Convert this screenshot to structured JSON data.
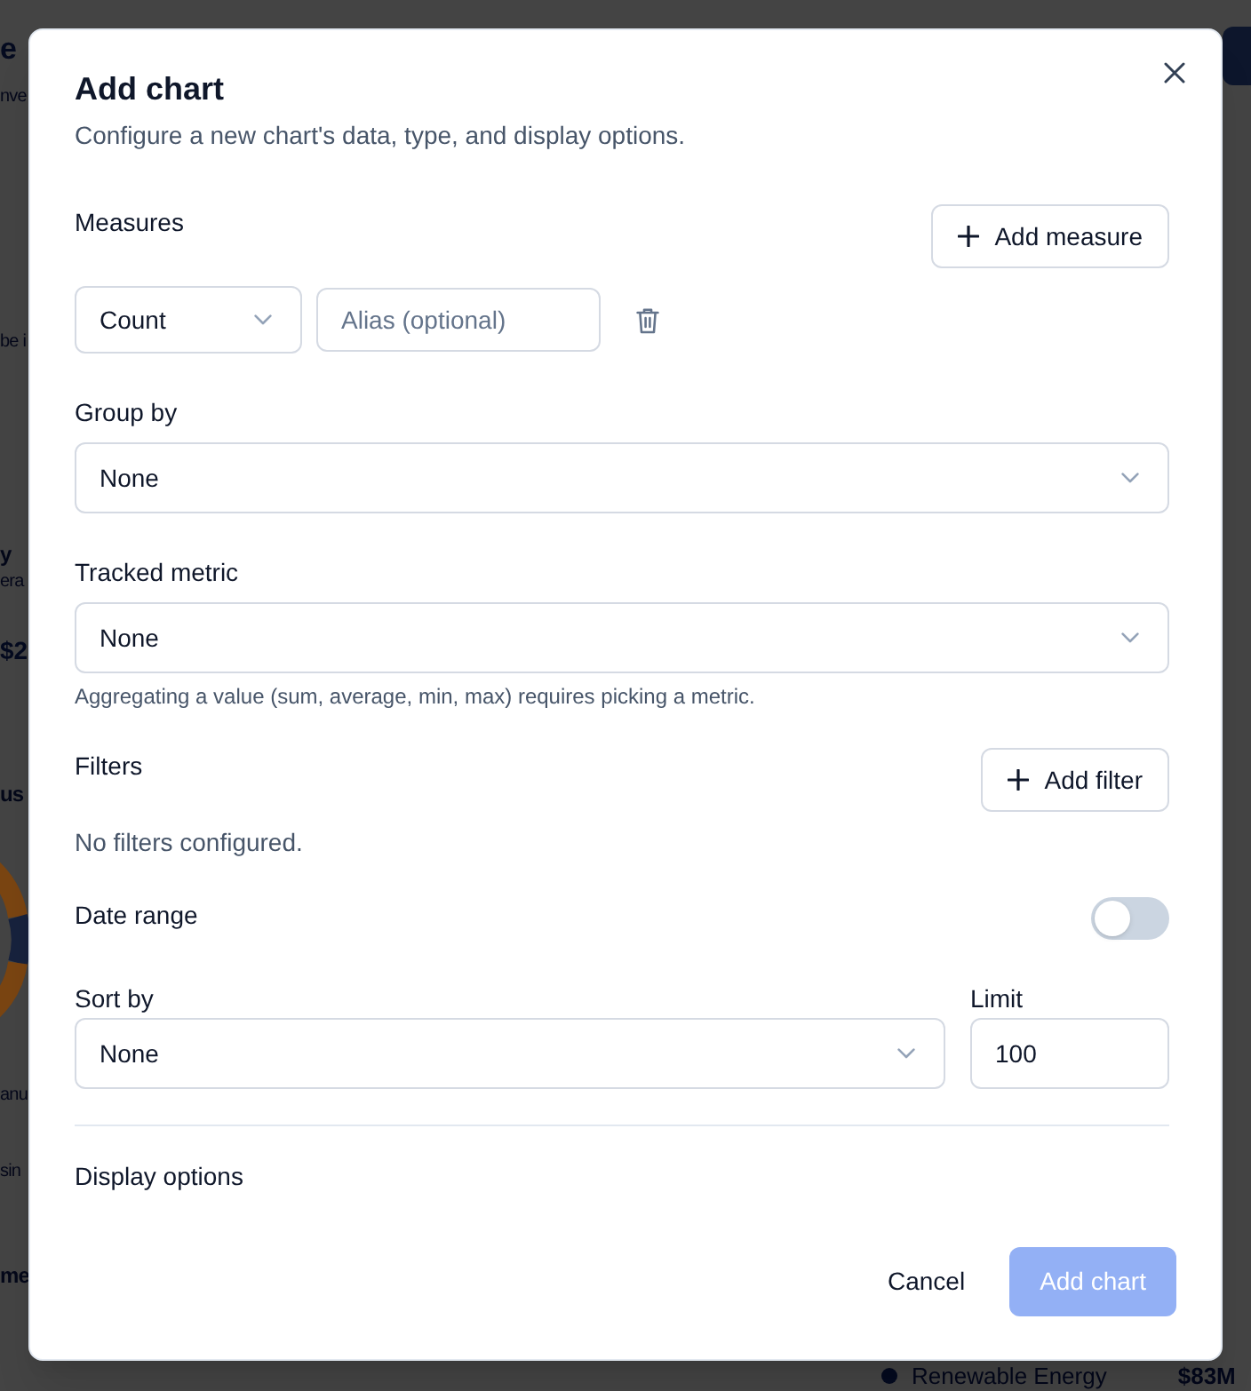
{
  "background": {
    "left_edge_upper": [
      {
        "kind": "title",
        "text": "e"
      },
      {
        "kind": "text",
        "text": "nve"
      },
      {
        "kind": "text",
        "text": "be i"
      },
      {
        "kind": "heading",
        "text": "y"
      },
      {
        "kind": "text",
        "text": "era"
      },
      {
        "kind": "value",
        "text": "$2"
      },
      {
        "kind": "heading",
        "text": "us"
      }
    ],
    "left_edge_lower": [
      {
        "kind": "text",
        "text": "anu"
      },
      {
        "kind": "text",
        "text": "sin"
      },
      {
        "kind": "heading",
        "text": "me"
      }
    ],
    "legend_item": {
      "label": "Renewable Energy",
      "value": "$83M"
    }
  },
  "dialog": {
    "title": "Add chart",
    "description": "Configure a new chart's data, type, and display options.",
    "measures": {
      "label": "Measures",
      "add_button": "Add measure",
      "rows": [
        {
          "aggregation": "Count",
          "alias_placeholder": "Alias (optional)"
        }
      ]
    },
    "group_by": {
      "label": "Group by",
      "value": "None"
    },
    "tracked_metric": {
      "label": "Tracked metric",
      "value": "None",
      "hint": "Aggregating a value (sum, average, min, max) requires picking a metric."
    },
    "filters": {
      "label": "Filters",
      "add_button": "Add filter",
      "empty_text": "No filters configured."
    },
    "date_range": {
      "label": "Date range",
      "on": false
    },
    "sort_by": {
      "label": "Sort by",
      "value": "None"
    },
    "limit": {
      "label": "Limit",
      "value": "100"
    },
    "display_options": {
      "label": "Display options"
    },
    "buttons": [
      {
        "label": "Cancel",
        "kind": "secondary",
        "disabled": false
      },
      {
        "label": "Add chart",
        "kind": "primary",
        "disabled": true
      }
    ]
  }
}
